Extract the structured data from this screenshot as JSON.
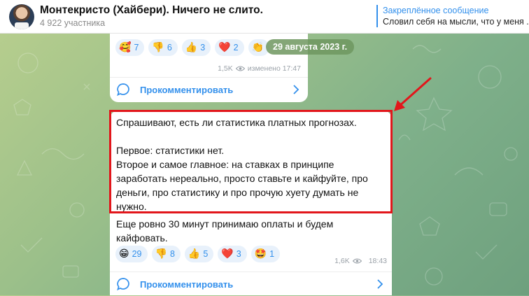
{
  "header": {
    "title": "Монтекристо (Хайбери). Ничего не слито.",
    "subtitle": "4 922 участника",
    "pinned_title": "Закреплённое сообщение",
    "pinned_text": "Словил себя на мысли, что у меня ..."
  },
  "date_pill": "29 августа 2023 г.",
  "top_post": {
    "reactions": [
      {
        "emoji": "🥰",
        "count": "7"
      },
      {
        "emoji": "👎",
        "count": "6"
      },
      {
        "emoji": "👍",
        "count": "3"
      },
      {
        "emoji": "❤️",
        "count": "2"
      },
      {
        "emoji": "👏",
        "count": ""
      }
    ],
    "views": "1,5K",
    "edited": "изменено 17:47",
    "comment_label": "Прокомментировать"
  },
  "main_post": {
    "lines": [
      "Спрашивают, есть ли статистика платных прогнозах.",
      "",
      "Первое: статистики нет.",
      "Второе и самое главное: на ставках в принципе",
      "заработать нереально, просто ставьте и кайфуйте, про",
      "деньги, про статистику и про прочую хуету думать не",
      "нужно."
    ],
    "after_lines": [
      "Еще ровно 30 минут принимаю оплаты и будем",
      "кайфовать."
    ],
    "reactions": [
      {
        "emoji": "😁",
        "count": "29"
      },
      {
        "emoji": "👎",
        "count": "8"
      },
      {
        "emoji": "👍",
        "count": "5"
      },
      {
        "emoji": "❤️",
        "count": "3"
      },
      {
        "emoji": "🤩",
        "count": "1"
      }
    ],
    "views": "1,6K",
    "time": "18:43",
    "comment_label": "Прокомментировать"
  },
  "colors": {
    "accent": "#3390ec",
    "highlight_border": "#e2161b",
    "reaction_bg": "#e8f1fb"
  }
}
